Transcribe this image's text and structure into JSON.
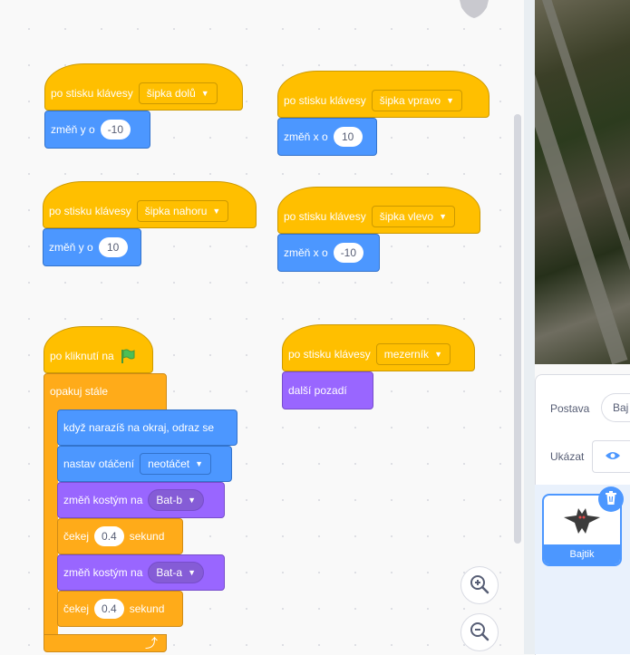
{
  "scripts": {
    "s1": {
      "hat": "po stisku klávesy",
      "key": "šipka dolů",
      "cmd": "změň y o",
      "val": "-10"
    },
    "s2": {
      "hat": "po stisku klávesy",
      "key": "šipka vpravo",
      "cmd": "změň x o",
      "val": "10"
    },
    "s3": {
      "hat": "po stisku klávesy",
      "key": "šipka nahoru",
      "cmd": "změň y o",
      "val": "10"
    },
    "s4": {
      "hat": "po stisku klávesy",
      "key": "šipka vlevo",
      "cmd": "změň x o",
      "val": "-10"
    },
    "s5": {
      "hat": "po stisku klávesy",
      "key": "mezerník",
      "cmd": "další pozadí"
    },
    "main": {
      "hat": "po kliknutí na",
      "forever": "opakuj stále",
      "bounce": "když narazíš na okraj, odraz se",
      "rotation": "nastav otáčení",
      "rotation_val": "neotáčet",
      "costume1": "změň kostým na",
      "costume1_val": "Bat-b",
      "wait1": "čekej",
      "wait1_val": "0.4",
      "wait1_unit": "sekund",
      "costume2": "změň kostým na",
      "costume2_val": "Bat-a",
      "wait2": "čekej",
      "wait2_val": "0.4",
      "wait2_unit": "sekund"
    }
  },
  "sprite_info": {
    "sprite_label": "Postava",
    "sprite_name_partial": "Baj",
    "show_label": "Ukázat"
  },
  "sprite_list": [
    {
      "name": "Bajtik"
    }
  ],
  "icons": {
    "green_flag": "green-flag-icon",
    "loop_arrow": "loop-arrow-icon",
    "zoom_in": "zoom-in-icon",
    "zoom_out": "zoom-out-icon",
    "eye": "eye-icon",
    "trash": "trash-icon"
  },
  "colors": {
    "events": "#ffbf00",
    "motion": "#4c97ff",
    "looks": "#9966ff",
    "control": "#ffab19",
    "accent": "#4c97ff"
  }
}
